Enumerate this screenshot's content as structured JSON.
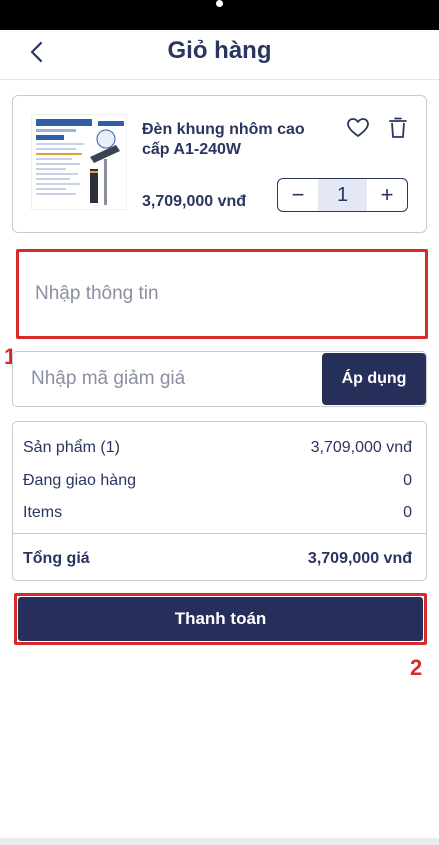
{
  "header": {
    "title": "Giỏ hàng",
    "back_icon": "chevron-left-icon"
  },
  "cart_item": {
    "name": "Đèn khung nhôm cao cấp A1-240W",
    "price": "3,709,000 vnđ",
    "quantity": "1",
    "decrement_label": "−",
    "increment_label": "+",
    "favorite_icon": "heart-icon",
    "delete_icon": "trash-icon",
    "thumbnail_brand": "E-Solar",
    "thumbnail_model": "240W"
  },
  "info_field": {
    "placeholder": "Nhập thông tin"
  },
  "coupon": {
    "placeholder": "Nhập mã giảm giá",
    "apply_label": "Áp dụng"
  },
  "summary": {
    "rows": [
      {
        "label": "Sản phẩm (1)",
        "value": "3,709,000 vnđ"
      },
      {
        "label": "Đang giao hàng",
        "value": "0"
      },
      {
        "label": "Items",
        "value": "0"
      }
    ],
    "total_label": "Tổng giá",
    "total_value": "3,709,000 vnđ"
  },
  "checkout": {
    "label": "Thanh toán"
  },
  "markers": {
    "first": "1",
    "second": "2"
  },
  "colors": {
    "primary": "#262f5a",
    "text": "#2a3560",
    "highlight": "#d52b2b",
    "border": "#c7cad5"
  }
}
